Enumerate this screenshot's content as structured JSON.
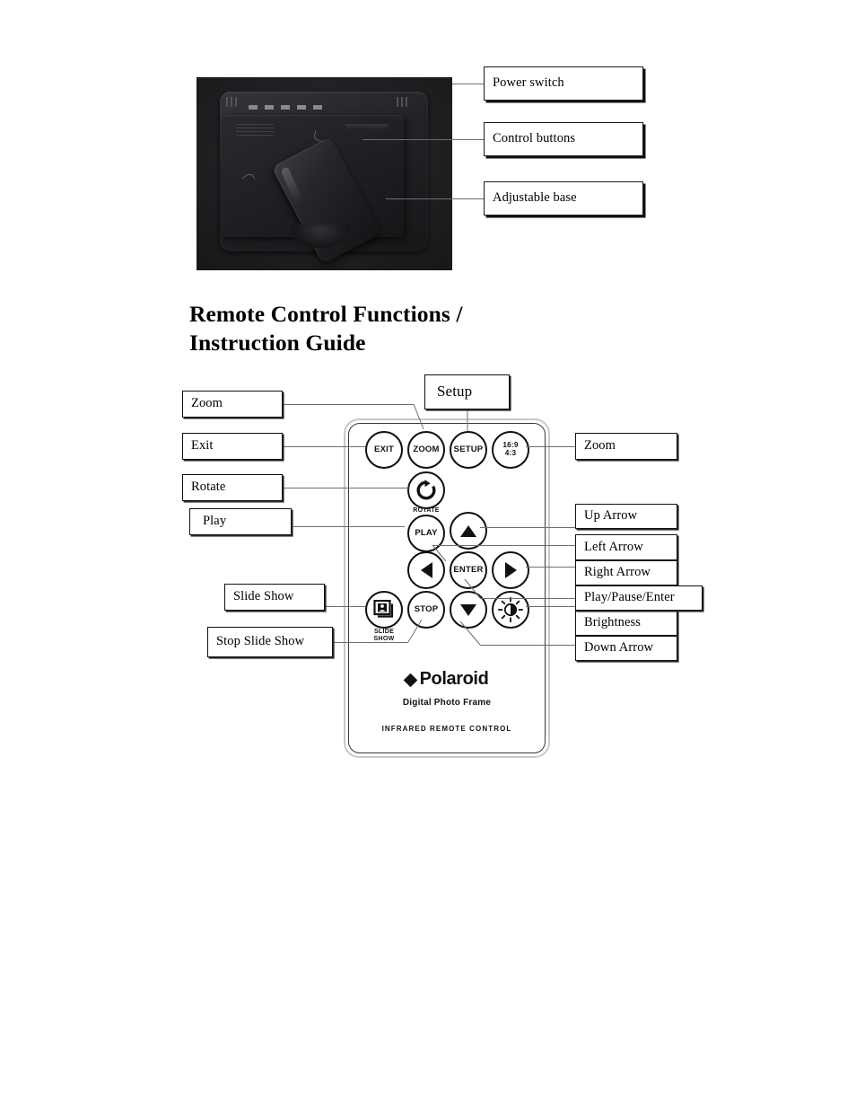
{
  "document": {
    "heading_line1": "Remote Control Functions /",
    "heading_line2": "Instruction Guide"
  },
  "photo_callouts": [
    {
      "label": "Power switch"
    },
    {
      "label": "Control buttons"
    },
    {
      "label": "Adjustable base"
    }
  ],
  "left_callouts": [
    {
      "label": "Zoom"
    },
    {
      "label": "Exit"
    },
    {
      "label": "Rotate"
    },
    {
      "label": "Play"
    },
    {
      "label": "Slide Show"
    },
    {
      "label": "Stop Slide Show"
    }
  ],
  "top_callout": {
    "label": "Setup"
  },
  "right_callouts": [
    {
      "label": "Zoom"
    },
    {
      "label": "Up Arrow"
    },
    {
      "label": "Left Arrow"
    },
    {
      "label": "Right Arrow"
    },
    {
      "label": "Play/Pause/Enter"
    },
    {
      "label": "Brightness"
    },
    {
      "label": "Down Arrow"
    }
  ],
  "remote": {
    "buttons": [
      {
        "id": "exit",
        "label": "EXIT"
      },
      {
        "id": "zoom",
        "label": "ZOOM"
      },
      {
        "id": "setup",
        "label": "SETUP"
      },
      {
        "id": "aspect",
        "label_line1": "16:9",
        "label_line2": "4:3"
      },
      {
        "id": "rotate",
        "icon": "rotate-icon",
        "sublabel": "ROTATE"
      },
      {
        "id": "play",
        "label": "PLAY"
      },
      {
        "id": "up",
        "icon": "triangle-up-icon"
      },
      {
        "id": "left",
        "icon": "triangle-left-icon"
      },
      {
        "id": "enter",
        "label": "ENTER"
      },
      {
        "id": "right",
        "icon": "triangle-right-icon"
      },
      {
        "id": "slideshow",
        "icon": "picture-frame-icon",
        "sublabel_line1": "SLIDE",
        "sublabel_line2": "SHOW"
      },
      {
        "id": "stop",
        "label": "STOP"
      },
      {
        "id": "down",
        "icon": "triangle-down-icon"
      },
      {
        "id": "brightness",
        "icon": "brightness-sun-icon"
      }
    ],
    "brand": "Polaroid",
    "product": "Digital Photo Frame",
    "footer": "INFRARED   REMOTE   CONTROL"
  }
}
